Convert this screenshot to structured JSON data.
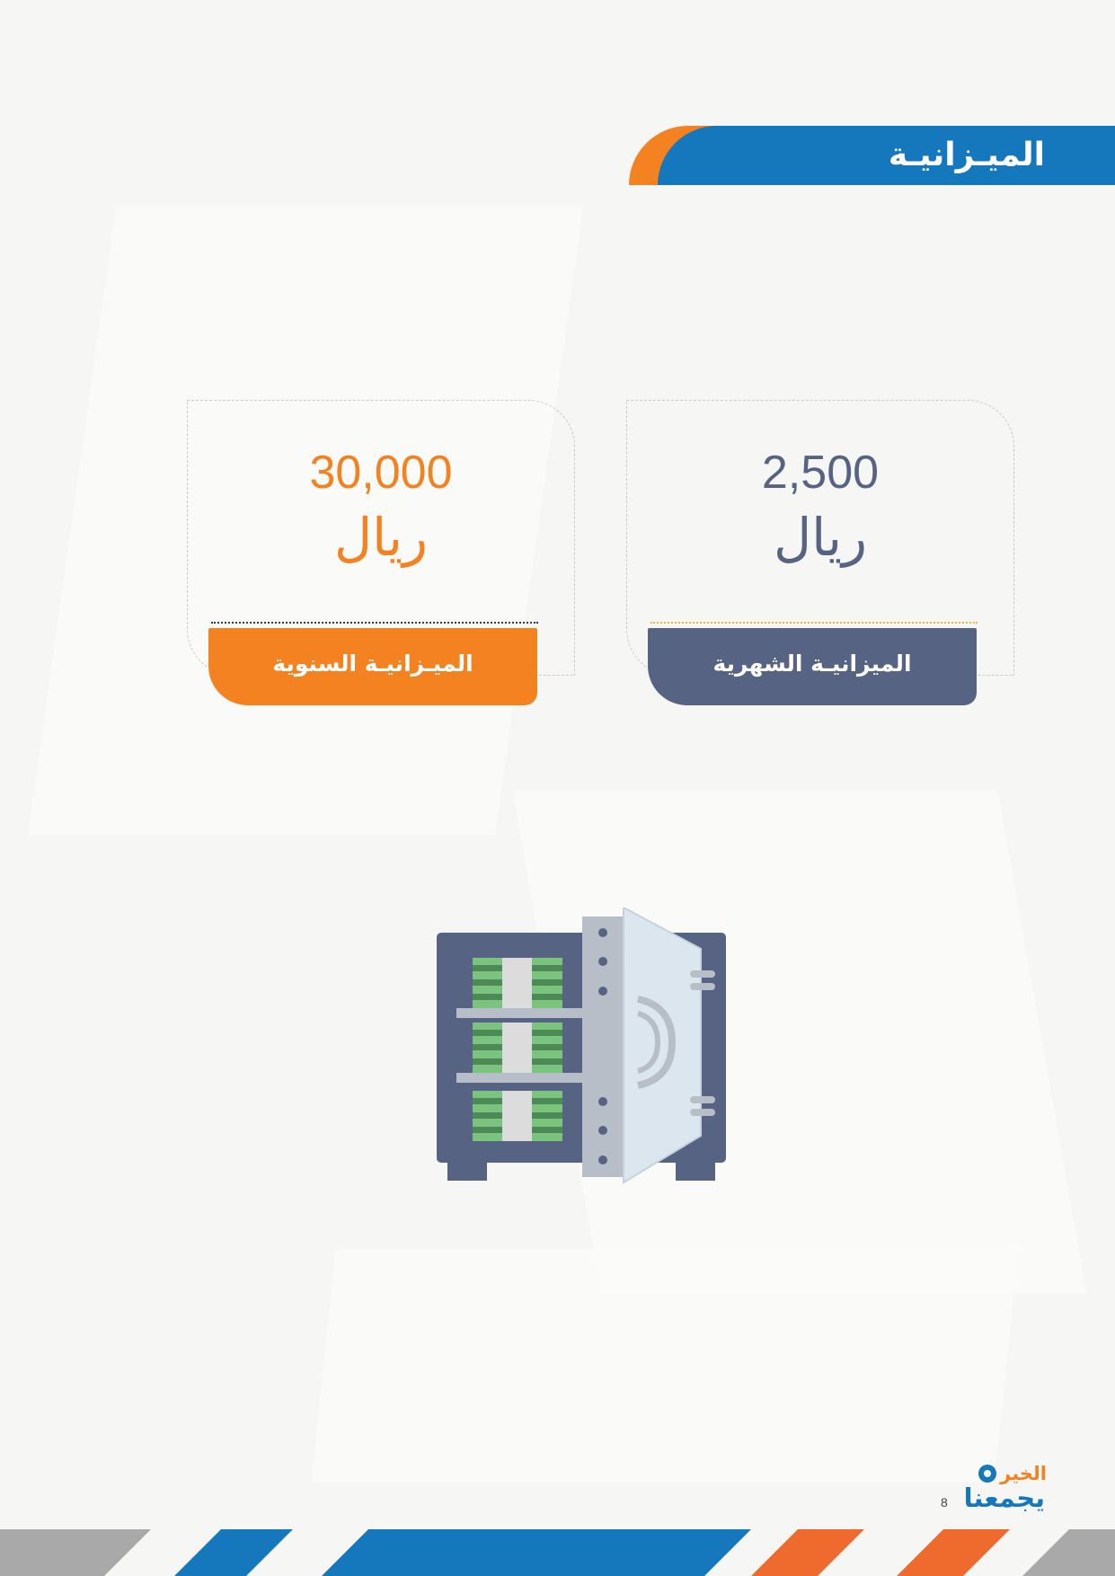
{
  "page": {
    "title": "الميـزانيـة",
    "page_number": "8"
  },
  "cards": {
    "annual": {
      "amount": "30,000",
      "currency": "ريال",
      "label": "الميـزانيـة السنوية"
    },
    "monthly": {
      "amount": "2,500",
      "currency": "ريال",
      "label": "الميزانيـة الشهرية"
    }
  },
  "logo": {
    "top_text": "الخير",
    "bottom_text": "يجمعنا"
  },
  "illustration": {
    "icon": "money-safe-icon"
  },
  "colors": {
    "brand_blue": "#1577bc",
    "brand_orange": "#f58220",
    "slate": "#566383",
    "background": "#f6f6f5"
  }
}
